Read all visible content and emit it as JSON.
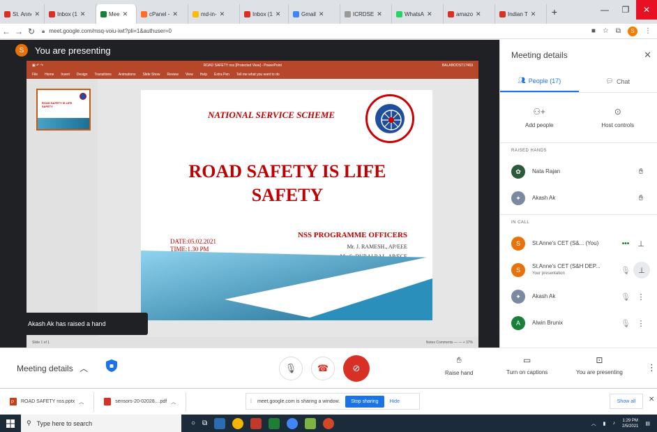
{
  "browser": {
    "tabs": [
      {
        "label": "St. Anne",
        "color": "#d93025"
      },
      {
        "label": "Inbox (1",
        "color": "#d93025"
      },
      {
        "label": "Mee",
        "color": "#188038",
        "active": true
      },
      {
        "label": "cPanel -",
        "color": "#ff6c2c"
      },
      {
        "label": "md-in-",
        "color": "#fbbc04"
      },
      {
        "label": "Inbox (1",
        "color": "#d93025"
      },
      {
        "label": "Gmail",
        "color": "#4285f4"
      },
      {
        "label": "ICRDSE",
        "color": "#999999"
      },
      {
        "label": "WhatsA",
        "color": "#25d366"
      },
      {
        "label": "amazo",
        "color": "#d93025"
      },
      {
        "label": "Indian T",
        "color": "#d93025"
      }
    ],
    "url": "meet.google.com/msq-voiu-iwt?pli=1&authuser=0",
    "profile_letter": "S"
  },
  "meet": {
    "presenting_avatar": "S",
    "presenting_text": "You are presenting",
    "toast": "Akash Ak has raised a hand"
  },
  "ppt": {
    "doc_title": "ROAD SAFETY nss [Protected View] - PowerPoint",
    "user": "BALABOOST17469",
    "ribbon": [
      "File",
      "Home",
      "Insert",
      "Design",
      "Transitions",
      "Animations",
      "Slide Show",
      "Review",
      "View",
      "Help",
      "Extra Pen",
      "Tell me what you want to do"
    ],
    "status_left": "Slide 1 of 1",
    "status_right": "Notes   Comments   —   — + 37%",
    "slide": {
      "header": "NATIONAL SERVICE SCHEME",
      "title_line1": "ROAD SAFETY IS LIFE",
      "title_line2": "SAFETY",
      "date": "DATE:05.02.2021",
      "time": "TIME:1.30 PM",
      "officers": "NSS PROGRAMME OFFICERS",
      "name1": "Mr. J. RAMESH., AP/EEE",
      "name2": "Mr. S. DURAI RAJ., AP/ECE"
    }
  },
  "panel": {
    "title": "Meeting details",
    "tab_people": "People (17)",
    "tab_chat": "Chat",
    "add_people": "Add people",
    "host_controls": "Host controls",
    "raised_hands_header": "RAISED HANDS",
    "raised": [
      {
        "name": "Nata Rajan"
      },
      {
        "name": "Akash Ak"
      }
    ],
    "in_call_header": "IN CALL",
    "in_call": [
      {
        "name": "St.Anne's CET (S&...  (You)",
        "sub": "",
        "avatar": "S"
      },
      {
        "name": "St.Anne's CET (S&H DEP...",
        "sub": "Your presentation",
        "avatar": "S"
      },
      {
        "name": "Akash Ak",
        "sub": "",
        "avatar": ""
      },
      {
        "name": "Alwin Brunix",
        "sub": "",
        "avatar": "A"
      }
    ]
  },
  "controls": {
    "meeting_details": "Meeting details",
    "raise_hand": "Raise hand",
    "captions": "Turn on captions",
    "presenting": "You are presenting"
  },
  "downloads": {
    "file1": "ROAD SAFETY nss.pptx",
    "file2": "sensors-20-02028....pdf",
    "sharing_text": "meet.google.com is sharing a window.",
    "stop_sharing": "Stop sharing",
    "hide": "Hide",
    "show_all": "Show all"
  },
  "taskbar": {
    "search_placeholder": "Type here to search",
    "time": "1:29 PM",
    "date": "2/5/2021"
  }
}
